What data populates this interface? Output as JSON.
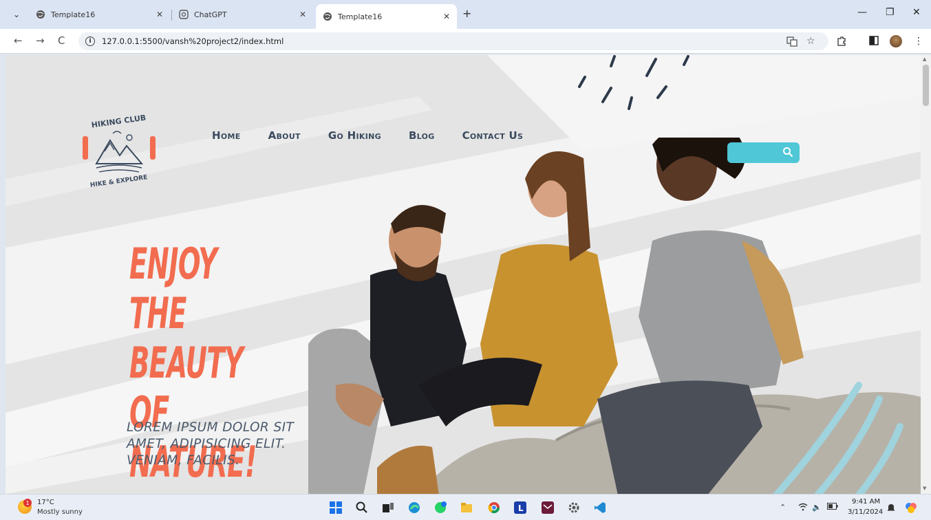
{
  "browser": {
    "tabs": [
      {
        "label": "Template16",
        "active": false
      },
      {
        "label": "ChatGPT",
        "active": false
      },
      {
        "label": "Template16",
        "active": true
      }
    ],
    "url": "127.0.0.1:5500/vansh%20project2/index.html"
  },
  "page": {
    "logo": {
      "top_text": "HIKING CLUB",
      "bottom_text": "HIKE & EXPLORE"
    },
    "nav": [
      "Home",
      "About",
      "Go Hiking",
      "Blog",
      "Contact Us"
    ],
    "search": {
      "value": ""
    },
    "hero": {
      "title_lines": [
        "ENJOY THE",
        "BEAUTY OF",
        "NATURE!"
      ],
      "subtitle": "LOREM IPSUM DOLOR SIT AMET, ADIPISICING ELIT. VENIAM, FACILIS."
    },
    "colors": {
      "accent": "#f26c4f",
      "search": "#4fc7d6",
      "nav": "#3a4a5e"
    }
  },
  "taskbar": {
    "weather": {
      "badge": "1",
      "temp": "17°C",
      "desc": "Mostly sunny"
    },
    "clock": {
      "time": "9:41 AM",
      "date": "3/11/2024"
    }
  }
}
